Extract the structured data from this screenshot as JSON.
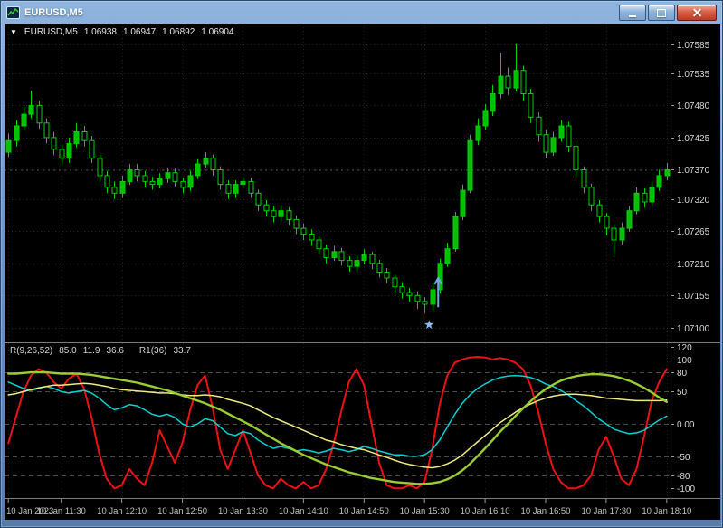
{
  "window": {
    "title": "EURUSD,M5",
    "controls": [
      {
        "name": "minimize"
      },
      {
        "name": "restore"
      },
      {
        "name": "close"
      }
    ]
  },
  "chart_header": {
    "dropdown_icon": "▼",
    "symbol": "EURUSD,M5",
    "ohlc": [
      "1.06938",
      "1.06947",
      "1.06892",
      "1.06904"
    ]
  },
  "chart_data": [
    {
      "type": "candlestick",
      "symbol": "EURUSD,M5",
      "timeframe": "M5",
      "ylim": [
        1.07075,
        1.0762
      ],
      "y_ticks": [
        1.07585,
        1.07535,
        1.0748,
        1.07425,
        1.0737,
        1.0732,
        1.07265,
        1.0721,
        1.07155,
        1.071
      ],
      "x_labels": [
        "10 Jan 2023",
        "10 Jan 11:30",
        "10 Jan 12:10",
        "10 Jan 12:50",
        "10 Jan 13:30",
        "10 Jan 14:10",
        "10 Jan 14:50",
        "10 Jan 15:30",
        "10 Jan 16:10",
        "10 Jan 16:50",
        "10 Jan 17:30",
        "10 Jan 18:10"
      ],
      "x_label_indices": [
        0,
        7,
        15,
        23,
        31,
        39,
        47,
        55,
        63,
        71,
        79,
        87
      ],
      "last_price": 1.0737,
      "colors": {
        "outline": "#00d000",
        "bull_fill": "#00c000",
        "bear_fill": "#000000",
        "grid": "#262626",
        "axis_text": "#d8d8d8"
      },
      "markers": [
        {
          "type": "star",
          "index": 55.6,
          "price": 1.07105,
          "color": "#8fb9e8"
        },
        {
          "type": "up-arrow",
          "index": 56.8,
          "price_from": 1.07135,
          "price_to": 1.07185,
          "color": "#74a7dc"
        }
      ],
      "candles": [
        [
          1.074,
          1.07432,
          1.07392,
          1.0742
        ],
        [
          1.0742,
          1.07455,
          1.0741,
          1.07445
        ],
        [
          1.07445,
          1.07478,
          1.07438,
          1.07465
        ],
        [
          1.07465,
          1.07505,
          1.07458,
          1.0748
        ],
        [
          1.0748,
          1.07488,
          1.0744,
          1.0745
        ],
        [
          1.0745,
          1.07458,
          1.07415,
          1.07425
        ],
        [
          1.07425,
          1.07435,
          1.07395,
          1.07405
        ],
        [
          1.07405,
          1.07412,
          1.07378,
          1.0739
        ],
        [
          1.0739,
          1.07425,
          1.07382,
          1.07415
        ],
        [
          1.07415,
          1.0745,
          1.07408,
          1.07435
        ],
        [
          1.07435,
          1.07445,
          1.0741,
          1.0742
        ],
        [
          1.0742,
          1.07428,
          1.07382,
          1.0739
        ],
        [
          1.0739,
          1.07396,
          1.0735,
          1.0736
        ],
        [
          1.0736,
          1.07368,
          1.0733,
          1.0734
        ],
        [
          1.0734,
          1.0735,
          1.0732,
          1.0733
        ],
        [
          1.0733,
          1.0736,
          1.07322,
          1.0735
        ],
        [
          1.0735,
          1.0738,
          1.07344,
          1.0737
        ],
        [
          1.0737,
          1.0738,
          1.0735,
          1.0736
        ],
        [
          1.0736,
          1.07368,
          1.0734,
          1.0735
        ],
        [
          1.0735,
          1.07358,
          1.07336,
          1.07345
        ],
        [
          1.07345,
          1.07364,
          1.07338,
          1.07355
        ],
        [
          1.07355,
          1.07374,
          1.07348,
          1.07365
        ],
        [
          1.07365,
          1.07372,
          1.07342,
          1.0735
        ],
        [
          1.0735,
          1.07356,
          1.0733,
          1.0734
        ],
        [
          1.0734,
          1.07368,
          1.07334,
          1.0736
        ],
        [
          1.0736,
          1.07388,
          1.07354,
          1.0738
        ],
        [
          1.0738,
          1.074,
          1.07374,
          1.0739
        ],
        [
          1.0739,
          1.07396,
          1.0736,
          1.0737
        ],
        [
          1.0737,
          1.07376,
          1.07336,
          1.07345
        ],
        [
          1.07345,
          1.07352,
          1.0732,
          1.0733
        ],
        [
          1.0733,
          1.07352,
          1.07322,
          1.07345
        ],
        [
          1.07345,
          1.07358,
          1.07338,
          1.0735
        ],
        [
          1.0735,
          1.07356,
          1.07322,
          1.0733
        ],
        [
          1.0733,
          1.07336,
          1.073,
          1.0731
        ],
        [
          1.0731,
          1.07318,
          1.0729,
          1.073
        ],
        [
          1.073,
          1.07308,
          1.0728,
          1.0729
        ],
        [
          1.0729,
          1.0731,
          1.07284,
          1.073
        ],
        [
          1.073,
          1.07306,
          1.07276,
          1.07285
        ],
        [
          1.07285,
          1.07292,
          1.0726,
          1.0727
        ],
        [
          1.0727,
          1.07278,
          1.0725,
          1.0726
        ],
        [
          1.0726,
          1.07268,
          1.0724,
          1.0725
        ],
        [
          1.0725,
          1.07256,
          1.07226,
          1.07235
        ],
        [
          1.07235,
          1.07242,
          1.0721,
          1.0722
        ],
        [
          1.0722,
          1.0724,
          1.07214,
          1.0723
        ],
        [
          1.0723,
          1.07236,
          1.07206,
          1.07215
        ],
        [
          1.07215,
          1.07222,
          1.07196,
          1.07205
        ],
        [
          1.07205,
          1.07224,
          1.07198,
          1.07215
        ],
        [
          1.07215,
          1.07234,
          1.07208,
          1.07225
        ],
        [
          1.07225,
          1.0723,
          1.072,
          1.0721
        ],
        [
          1.0721,
          1.07216,
          1.07186,
          1.07195
        ],
        [
          1.07195,
          1.07202,
          1.07176,
          1.07185
        ],
        [
          1.07185,
          1.0719,
          1.0716,
          1.0717
        ],
        [
          1.0717,
          1.07178,
          1.0715,
          1.0716
        ],
        [
          1.0716,
          1.07168,
          1.07144,
          1.07155
        ],
        [
          1.07155,
          1.07162,
          1.07132,
          1.07145
        ],
        [
          1.07145,
          1.07152,
          1.07125,
          1.0714
        ],
        [
          1.0714,
          1.07175,
          1.0713,
          1.07165
        ],
        [
          1.07165,
          1.07218,
          1.07158,
          1.0721
        ],
        [
          1.0721,
          1.07245,
          1.07204,
          1.07235
        ],
        [
          1.07235,
          1.07298,
          1.0723,
          1.0729
        ],
        [
          1.0729,
          1.07345,
          1.07284,
          1.07335
        ],
        [
          1.07335,
          1.0743,
          1.0733,
          1.0742
        ],
        [
          1.0742,
          1.07458,
          1.07412,
          1.07445
        ],
        [
          1.07445,
          1.07482,
          1.07438,
          1.0747
        ],
        [
          1.0747,
          1.07515,
          1.07462,
          1.075
        ],
        [
          1.075,
          1.0757,
          1.07492,
          1.0753
        ],
        [
          1.0753,
          1.07545,
          1.07498,
          1.0751
        ],
        [
          1.0751,
          1.07585,
          1.07504,
          1.0754
        ],
        [
          1.0754,
          1.07548,
          1.07488,
          1.075
        ],
        [
          1.075,
          1.07508,
          1.0745,
          1.0746
        ],
        [
          1.0746,
          1.07468,
          1.07418,
          1.0743
        ],
        [
          1.0743,
          1.07438,
          1.0739,
          1.074
        ],
        [
          1.074,
          1.07435,
          1.07394,
          1.07425
        ],
        [
          1.07425,
          1.07455,
          1.07418,
          1.07445
        ],
        [
          1.07445,
          1.07452,
          1.074,
          1.0741
        ],
        [
          1.0741,
          1.07416,
          1.0736,
          1.0737
        ],
        [
          1.0737,
          1.07376,
          1.0733,
          1.0734
        ],
        [
          1.0734,
          1.07346,
          1.073,
          1.0731
        ],
        [
          1.0731,
          1.07318,
          1.0728,
          1.0729
        ],
        [
          1.0729,
          1.07296,
          1.07258,
          1.0727
        ],
        [
          1.0727,
          1.07276,
          1.07225,
          1.0725
        ],
        [
          1.0725,
          1.0728,
          1.07242,
          1.0727
        ],
        [
          1.0727,
          1.07308,
          1.07264,
          1.073
        ],
        [
          1.073,
          1.0734,
          1.07294,
          1.0733
        ],
        [
          1.0733,
          1.07338,
          1.07305,
          1.07315
        ],
        [
          1.07315,
          1.0735,
          1.07308,
          1.0734
        ],
        [
          1.0734,
          1.0737,
          1.07334,
          1.0736
        ],
        [
          1.0736,
          1.07382,
          1.07352,
          1.0737
        ]
      ]
    },
    {
      "type": "line",
      "label": "R(9,26,52)",
      "values": [
        "85.0",
        "11.9",
        "36.6"
      ],
      "label2": "R1(36)",
      "value2": "33.7",
      "ylim": [
        -115,
        125
      ],
      "y_ticks": [
        {
          "v": 120,
          "label": "120"
        },
        {
          "v": 100,
          "label": "100"
        },
        {
          "v": 80,
          "label": "80"
        },
        {
          "v": 50,
          "label": "50"
        },
        {
          "v": 0,
          "label": "0.00"
        },
        {
          "v": -50,
          "label": "-50"
        },
        {
          "v": -80,
          "label": "-80"
        },
        {
          "v": -100,
          "label": "-100"
        }
      ],
      "levels": [
        80,
        50,
        0,
        -50,
        -80
      ],
      "series": [
        {
          "name": "R-9",
          "color": "#ee1111",
          "width": 2,
          "values": [
            -30,
            10,
            50,
            75,
            85,
            80,
            65,
            55,
            70,
            78,
            55,
            10,
            -45,
            -85,
            -100,
            -95,
            -70,
            -85,
            -95,
            -60,
            -10,
            -35,
            -60,
            -30,
            20,
            60,
            75,
            25,
            -40,
            -70,
            -40,
            -10,
            -45,
            -80,
            -95,
            -100,
            -85,
            -95,
            -100,
            -90,
            -100,
            -95,
            -70,
            -30,
            20,
            65,
            85,
            60,
            0,
            -60,
            -95,
            -100,
            -100,
            -95,
            -100,
            -90,
            -40,
            30,
            75,
            95,
            100,
            103,
            104,
            103,
            100,
            102,
            100,
            95,
            85,
            60,
            20,
            -30,
            -70,
            -90,
            -100,
            -100,
            -95,
            -80,
            -40,
            -20,
            -50,
            -85,
            -95,
            -70,
            -20,
            35,
            65,
            85
          ]
        },
        {
          "name": "R-26",
          "color": "#00d2d2",
          "width": 1.5,
          "values": [
            65,
            60,
            55,
            52,
            55,
            58,
            55,
            50,
            48,
            50,
            52,
            48,
            40,
            30,
            22,
            25,
            30,
            28,
            22,
            15,
            12,
            15,
            10,
            0,
            -5,
            0,
            8,
            5,
            -5,
            -15,
            -18,
            -12,
            -15,
            -25,
            -32,
            -38,
            -35,
            -38,
            -42,
            -40,
            -42,
            -45,
            -42,
            -38,
            -40,
            -43,
            -40,
            -35,
            -38,
            -42,
            -45,
            -48,
            -48,
            -50,
            -50,
            -48,
            -40,
            -25,
            -5,
            15,
            32,
            45,
            55,
            62,
            68,
            72,
            74,
            75,
            74,
            72,
            68,
            62,
            58,
            52,
            45,
            36,
            28,
            18,
            8,
            0,
            -8,
            -12,
            -15,
            -14,
            -10,
            -2,
            6,
            12
          ]
        },
        {
          "name": "R-52",
          "color": "#ecec82",
          "width": 1.5,
          "values": [
            45,
            47,
            50,
            53,
            56,
            58,
            60,
            60,
            61,
            62,
            63,
            62,
            60,
            58,
            55,
            53,
            52,
            51,
            50,
            49,
            48,
            48,
            47,
            45,
            44,
            44,
            45,
            44,
            42,
            38,
            35,
            32,
            28,
            22,
            16,
            10,
            5,
            0,
            -5,
            -10,
            -15,
            -20,
            -25,
            -28,
            -32,
            -35,
            -38,
            -40,
            -44,
            -48,
            -52,
            -56,
            -60,
            -63,
            -65,
            -67,
            -68,
            -66,
            -62,
            -56,
            -48,
            -38,
            -28,
            -18,
            -8,
            2,
            10,
            18,
            25,
            31,
            36,
            40,
            43,
            45,
            46,
            46,
            45,
            44,
            42,
            40,
            39,
            38,
            37,
            36,
            36,
            36,
            36,
            37
          ]
        },
        {
          "name": "R1-36",
          "color": "#9acd32",
          "width": 2.4,
          "values": [
            78,
            78,
            79,
            80,
            80,
            80,
            79,
            78,
            78,
            78,
            77,
            76,
            74,
            72,
            70,
            68,
            66,
            64,
            61,
            58,
            55,
            52,
            48,
            44,
            40,
            36,
            32,
            27,
            22,
            16,
            10,
            4,
            -2,
            -9,
            -16,
            -23,
            -30,
            -36,
            -42,
            -48,
            -53,
            -58,
            -63,
            -67,
            -71,
            -75,
            -78,
            -81,
            -84,
            -86,
            -88,
            -90,
            -91,
            -92,
            -93,
            -93,
            -92,
            -90,
            -86,
            -80,
            -72,
            -62,
            -50,
            -38,
            -25,
            -12,
            0,
            12,
            24,
            35,
            45,
            54,
            61,
            67,
            71,
            74,
            76,
            77,
            77,
            76,
            74,
            71,
            67,
            62,
            56,
            49,
            41,
            34
          ]
        }
      ]
    }
  ]
}
